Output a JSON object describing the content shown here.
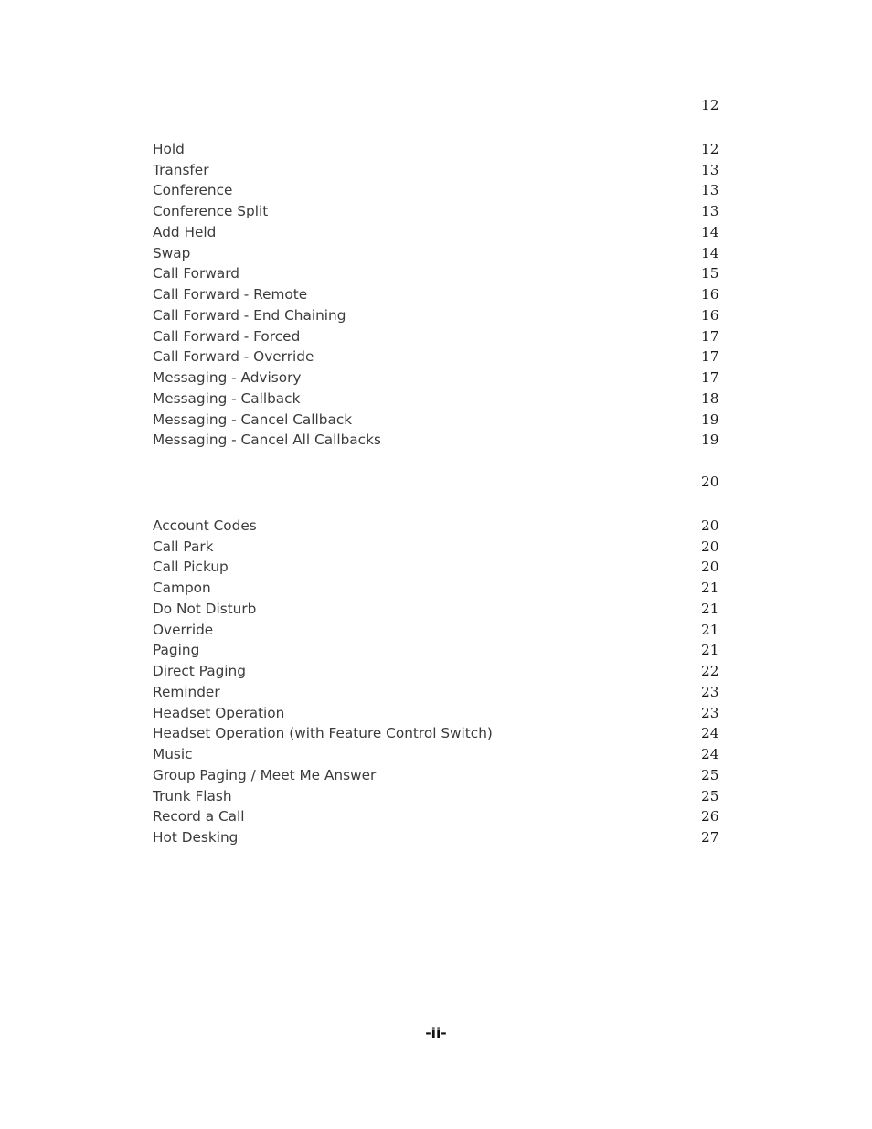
{
  "document": {
    "type": "table-of-contents",
    "background_color": "#ffffff",
    "text_color": "#3b3b3b",
    "page_number_color": "#191919"
  },
  "toc": {
    "sections": [
      {
        "heading": {
          "label": "",
          "page": "12"
        },
        "entries": [
          {
            "label": "Hold",
            "page": "12"
          },
          {
            "label": "Transfer",
            "page": "13"
          },
          {
            "label": "Conference",
            "page": "13"
          },
          {
            "label": "Conference Split",
            "page": "13"
          },
          {
            "label": "Add Held",
            "page": "14"
          },
          {
            "label": "Swap",
            "page": "14"
          },
          {
            "label": "Call Forward",
            "page": "15"
          },
          {
            "label": "Call Forward - Remote",
            "page": "16"
          },
          {
            "label": "Call Forward - End Chaining",
            "page": "16"
          },
          {
            "label": "Call Forward - Forced",
            "page": "17"
          },
          {
            "label": "Call Forward - Override",
            "page": "17"
          },
          {
            "label": "Messaging - Advisory",
            "page": "17"
          },
          {
            "label": "Messaging - Callback",
            "page": "18"
          },
          {
            "label": "Messaging - Cancel Callback",
            "page": "19"
          },
          {
            "label": "Messaging - Cancel All Callbacks",
            "page": "19"
          }
        ]
      },
      {
        "heading": {
          "label": "",
          "page": "20"
        },
        "entries": [
          {
            "label": "Account Codes",
            "page": "20"
          },
          {
            "label": "Call Park",
            "page": "20"
          },
          {
            "label": "Call Pickup",
            "page": "20"
          },
          {
            "label": "Campon",
            "page": "21"
          },
          {
            "label": "Do Not Disturb",
            "page": "21"
          },
          {
            "label": "Override",
            "page": "21"
          },
          {
            "label": "Paging",
            "page": "21"
          },
          {
            "label": "Direct Paging",
            "page": "22"
          },
          {
            "label": "Reminder",
            "page": "23"
          },
          {
            "label": "Headset Operation",
            "page": "23"
          },
          {
            "label": "Headset Operation (with Feature Control Switch)",
            "page": "24"
          },
          {
            "label": "Music",
            "page": "24"
          },
          {
            "label": "Group Paging / Meet Me Answer",
            "page": "25"
          },
          {
            "label": "Trunk Flash",
            "page": "25"
          },
          {
            "label": "Record a Call",
            "page": "26"
          },
          {
            "label": "Hot Desking",
            "page": "27"
          }
        ]
      }
    ]
  },
  "footer": {
    "page_marker": "-ii-"
  }
}
